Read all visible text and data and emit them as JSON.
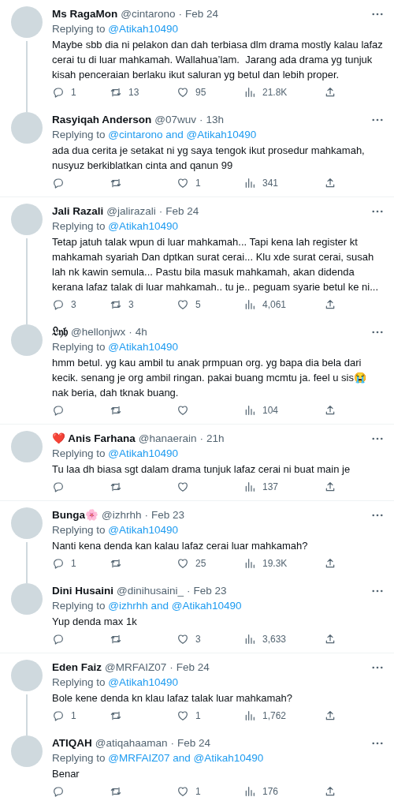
{
  "tweets": [
    {
      "name": "Ms RagaMon",
      "handle": "@cintarono",
      "separator": "·",
      "time": "Feb 24",
      "reply_label": "Replying to",
      "reply_to": "@Atikah10490",
      "text": "Maybe sbb dia ni pelakon dan dah terbiasa dlm drama mostly kalau lafaz cerai tu di luar mahkamah. Wallahua’lam.  Jarang ada drama yg tunjuk kisah penceraian berlaku ikut saluran yg betul dan lebih proper.",
      "replies": "1",
      "retweets": "13",
      "likes": "95",
      "views": "21.8K",
      "connected_to_next": true
    },
    {
      "name": "Rasyiqah Anderson",
      "handle": "@07wuv",
      "separator": "·",
      "time": "13h",
      "reply_label": "Replying to",
      "reply_to": "@cintarono and @Atikah10490",
      "text": "ada dua cerita je setakat ni yg saya tengok ikut prosedur mahkamah, nusyuz berkiblatkan cinta and qanun 99",
      "likes": "1",
      "views": "341",
      "connected_to_next": false
    },
    {
      "name": "Jali Razali",
      "handle": "@jalirazali",
      "separator": "·",
      "time": "Feb 24",
      "reply_label": "Replying to",
      "reply_to": "@Atikah10490",
      "text": "Tetap jatuh talak wpun di luar mahkamah... Tapi kena lah register kt mahkamah syariah Dan dptkan surat cerai... Klu xde surat cerai, susah lah nk kawin semula... Pastu bila masuk mahkamah, akan didenda kerana lafaz talak di luar mahkamah.. tu je.. peguam syarie betul ke ni...",
      "replies": "3",
      "retweets": "3",
      "likes": "5",
      "views": "4,061",
      "connected_to_next": true
    },
    {
      "name": "𝔏𝔶𝔥",
      "handle": "@hellonjwx",
      "separator": "·",
      "time": "4h",
      "reply_label": "Replying to",
      "reply_to": "@Atikah10490",
      "text": "hmm betul. yg kau ambil tu anak prmpuan org. yg bapa dia bela dari kecik. senang je org ambil ringan. pakai buang mcmtu ja. feel u sis😭 nak beria, dah tknak buang.",
      "views": "104",
      "connected_to_next": false
    },
    {
      "name": "❤️ Anis Farhana",
      "handle": "@hanaerain",
      "separator": "·",
      "time": "21h",
      "reply_label": "Replying to",
      "reply_to": "@Atikah10490",
      "text": "Tu laa dh biasa sgt dalam drama tunjuk lafaz cerai ni buat main je",
      "views": "137",
      "connected_to_next": false
    },
    {
      "name": "Bunga🌸",
      "handle": "@izhrhh",
      "separator": "·",
      "time": "Feb 23",
      "reply_label": "Replying to",
      "reply_to": "@Atikah10490",
      "text": "Nanti kena denda kan kalau lafaz cerai luar mahkamah?",
      "replies": "1",
      "likes": "25",
      "views": "19.3K",
      "connected_to_next": true
    },
    {
      "name": "Dini Husaini",
      "handle": "@dinihusaini_",
      "separator": "·",
      "time": "Feb 23",
      "reply_label": "Replying to",
      "reply_to": "@izhrhh and @Atikah10490",
      "text": "Yup denda max 1k",
      "likes": "3",
      "views": "3,633",
      "connected_to_next": false
    },
    {
      "name": "Eden Faiz",
      "handle": "@MRFAIZ07",
      "separator": "·",
      "time": "Feb 24",
      "reply_label": "Replying to",
      "reply_to": "@Atikah10490",
      "text": "Bole kene denda kn klau lafaz talak luar mahkamah?",
      "replies": "1",
      "likes": "1",
      "views": "1,762",
      "connected_to_next": true
    },
    {
      "name": "ATIQAH",
      "handle": "@atiqahaaman",
      "separator": "·",
      "time": "Feb 24",
      "reply_label": "Replying to",
      "reply_to": "@MRFAIZ07 and @Atikah10490",
      "text": "Benar",
      "likes": "1",
      "views": "176",
      "connected_to_next": false
    }
  ]
}
